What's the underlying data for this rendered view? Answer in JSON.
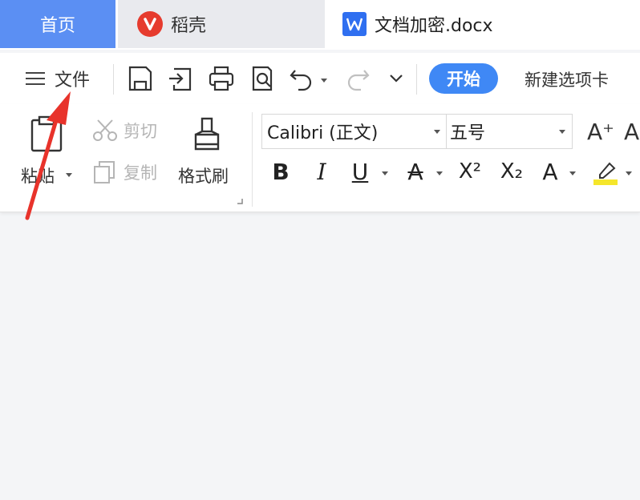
{
  "tabs": {
    "home": "首页",
    "daoke": "稻壳",
    "document": "文档加密.docx"
  },
  "quickbar": {
    "file_menu": "文件",
    "start_button": "开始",
    "new_tab": "新建选项卡"
  },
  "ribbon": {
    "paste": "粘贴",
    "cut": "剪切",
    "copy": "复制",
    "format_painter": "格式刷",
    "font_name": "Calibri (正文)",
    "font_size": "五号",
    "bold": "B",
    "italic": "I",
    "underline": "U",
    "strikethrough": "A",
    "superscript": "X²",
    "subscript": "X₂",
    "text_effect": "A",
    "grow_font": "A⁺"
  },
  "colors": {
    "accent_blue": "#3f88f5",
    "home_tab": "#5b8ff3",
    "annotation_red": "#e8332b",
    "highlight_yellow": "#f5e62b"
  }
}
